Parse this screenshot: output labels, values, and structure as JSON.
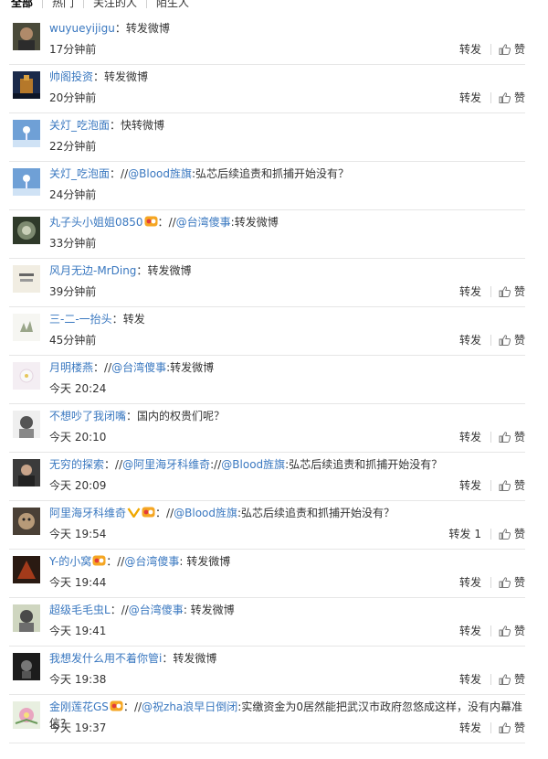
{
  "tabs": [
    "全部",
    "热门",
    "关注的人",
    "陌生人"
  ],
  "actions": {
    "repost": "转发",
    "like": "赞"
  },
  "comments": [
    {
      "user": "wuyueyijigu",
      "badge": false,
      "vip": false,
      "segments": [
        {
          "t": "转发微博",
          "link": false
        }
      ],
      "time": "17分钟前",
      "show_actions": true,
      "repost_count": ""
    },
    {
      "user": "帅阁投资",
      "badge": false,
      "vip": false,
      "segments": [
        {
          "t": "转发微博",
          "link": false
        }
      ],
      "time": "20分钟前",
      "show_actions": true,
      "repost_count": ""
    },
    {
      "user": "关灯_吃泡面",
      "badge": false,
      "vip": false,
      "segments": [
        {
          "t": "快转微博",
          "link": false
        }
      ],
      "time": "22分钟前",
      "show_actions": false,
      "repost_count": ""
    },
    {
      "user": "关灯_吃泡面",
      "badge": false,
      "vip": false,
      "segments": [
        {
          "t": "//",
          "link": false
        },
        {
          "t": "@Blood旌旗",
          "link": true
        },
        {
          "t": ":弘芯后续追责和抓捕开始没有？",
          "link": false
        }
      ],
      "time": "24分钟前",
      "show_actions": false,
      "repost_count": ""
    },
    {
      "user": "丸子头小姐姐0850",
      "badge": true,
      "vip": false,
      "segments": [
        {
          "t": "//",
          "link": false
        },
        {
          "t": "@台湾傻事",
          "link": true
        },
        {
          "t": ":转发微博",
          "link": false
        }
      ],
      "time": "33分钟前",
      "show_actions": false,
      "repost_count": ""
    },
    {
      "user": "风月无边-MrDing",
      "badge": false,
      "vip": false,
      "segments": [
        {
          "t": "转发微博",
          "link": false
        }
      ],
      "time": "39分钟前",
      "show_actions": true,
      "repost_count": ""
    },
    {
      "user": "三-二-一抬头",
      "badge": false,
      "vip": false,
      "segments": [
        {
          "t": "转发",
          "link": false
        }
      ],
      "time": "45分钟前",
      "show_actions": true,
      "repost_count": ""
    },
    {
      "user": "月明楼燕",
      "badge": false,
      "vip": false,
      "segments": [
        {
          "t": "//",
          "link": false
        },
        {
          "t": "@台湾傻事",
          "link": true
        },
        {
          "t": ":转发微博",
          "link": false
        }
      ],
      "time": "今天 20:24",
      "show_actions": false,
      "repost_count": ""
    },
    {
      "user": "不想吵了我闭嘴",
      "badge": false,
      "vip": false,
      "segments": [
        {
          "t": "国内的权贵们呢？",
          "link": false
        }
      ],
      "time": "今天 20:10",
      "show_actions": true,
      "repost_count": ""
    },
    {
      "user": "无穷的探索",
      "badge": false,
      "vip": false,
      "segments": [
        {
          "t": "//",
          "link": false
        },
        {
          "t": "@阿里海牙科维奇",
          "link": true
        },
        {
          "t": "://",
          "link": false
        },
        {
          "t": "@Blood旌旗",
          "link": true
        },
        {
          "t": ":弘芯后续追责和抓捕开始没有？",
          "link": false
        }
      ],
      "time": "今天 20:09",
      "show_actions": true,
      "repost_count": ""
    },
    {
      "user": "阿里海牙科维奇",
      "badge": true,
      "vip": true,
      "segments": [
        {
          "t": "//",
          "link": false
        },
        {
          "t": "@Blood旌旗",
          "link": true
        },
        {
          "t": ":弘芯后续追责和抓捕开始没有？",
          "link": false
        }
      ],
      "time": "今天 19:54",
      "show_actions": true,
      "repost_count": "1"
    },
    {
      "user": "Y-的小窝",
      "badge": true,
      "vip": false,
      "segments": [
        {
          "t": "//",
          "link": false
        },
        {
          "t": "@台湾傻事",
          "link": true
        },
        {
          "t": ": 转发微博",
          "link": false
        }
      ],
      "time": "今天 19:44",
      "show_actions": true,
      "repost_count": ""
    },
    {
      "user": "超级毛毛虫L",
      "badge": false,
      "vip": false,
      "segments": [
        {
          "t": "//",
          "link": false
        },
        {
          "t": "@台湾傻事",
          "link": true
        },
        {
          "t": ": 转发微博",
          "link": false
        }
      ],
      "time": "今天 19:41",
      "show_actions": true,
      "repost_count": ""
    },
    {
      "user": "我想发什么用不着你管i",
      "badge": false,
      "vip": false,
      "segments": [
        {
          "t": "转发微博",
          "link": false
        }
      ],
      "time": "今天 19:38",
      "show_actions": true,
      "repost_count": ""
    },
    {
      "user": "金刚莲花GS",
      "badge": true,
      "vip": false,
      "segments": [
        {
          "t": "//",
          "link": false
        },
        {
          "t": "@祝zha浪早日倒闭",
          "link": true
        },
        {
          "t": ":实缴资金为0居然能把武汉市政府忽悠成这样，没有内幕准信?",
          "link": false
        }
      ],
      "time": "今天 19:37",
      "show_actions": true,
      "repost_count": ""
    }
  ]
}
